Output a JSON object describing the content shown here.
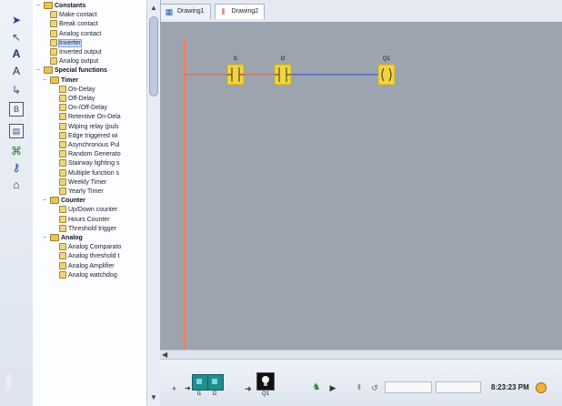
{
  "window": {
    "side_label": "Tools"
  },
  "toolbar_left": {
    "icons": [
      "arrow-icon",
      "select-icon",
      "letter-a-icon",
      "letter-a-arrow-icon",
      "connector-icon",
      "block-icon",
      "terminal-icon",
      "network-icon",
      "key-icon",
      "graph-icon"
    ]
  },
  "library": {
    "items": [
      {
        "label": "Constants",
        "kind": "folder",
        "level": 0,
        "toggle": "−"
      },
      {
        "label": "Make contact",
        "kind": "item",
        "level": 1,
        "toggle": ""
      },
      {
        "label": "Break contact",
        "kind": "item",
        "level": 1,
        "toggle": ""
      },
      {
        "label": "Analog contact",
        "kind": "item",
        "level": 1,
        "toggle": ""
      },
      {
        "label": "Inverter",
        "kind": "item",
        "level": 1,
        "toggle": "",
        "selected": true
      },
      {
        "label": "Inverted output",
        "kind": "item",
        "level": 1,
        "toggle": ""
      },
      {
        "label": "Analog output",
        "kind": "item",
        "level": 1,
        "toggle": ""
      },
      {
        "label": "Special functions",
        "kind": "folder",
        "level": 0,
        "toggle": "−"
      },
      {
        "label": "Timer",
        "kind": "folder",
        "level": 1,
        "toggle": "−"
      },
      {
        "label": "On-Delay",
        "kind": "item",
        "level": 2,
        "toggle": ""
      },
      {
        "label": "Off-Delay",
        "kind": "item",
        "level": 2,
        "toggle": ""
      },
      {
        "label": "On-/Off-Delay",
        "kind": "item",
        "level": 2,
        "toggle": ""
      },
      {
        "label": "Retentive On-Dela",
        "kind": "item",
        "level": 2,
        "toggle": ""
      },
      {
        "label": "Wiping relay (puls",
        "kind": "item",
        "level": 2,
        "toggle": ""
      },
      {
        "label": "Edge triggered wi",
        "kind": "item",
        "level": 2,
        "toggle": ""
      },
      {
        "label": "Asynchronous Pul",
        "kind": "item",
        "level": 2,
        "toggle": ""
      },
      {
        "label": "Random Generato",
        "kind": "item",
        "level": 2,
        "toggle": ""
      },
      {
        "label": "Stairway lighting s",
        "kind": "item",
        "level": 2,
        "toggle": ""
      },
      {
        "label": "Multiple function s",
        "kind": "item",
        "level": 2,
        "toggle": ""
      },
      {
        "label": "Weekly Timer",
        "kind": "item",
        "level": 2,
        "toggle": ""
      },
      {
        "label": "Yearly Timer",
        "kind": "item",
        "level": 2,
        "toggle": ""
      },
      {
        "label": "Counter",
        "kind": "folder",
        "level": 1,
        "toggle": "−"
      },
      {
        "label": "Up/Down counter",
        "kind": "item",
        "level": 2,
        "toggle": ""
      },
      {
        "label": "Hours Counter",
        "kind": "item",
        "level": 2,
        "toggle": ""
      },
      {
        "label": "Threshold trigger",
        "kind": "item",
        "level": 2,
        "toggle": ""
      },
      {
        "label": "Analog",
        "kind": "folder",
        "level": 1,
        "toggle": "−"
      },
      {
        "label": "Analog Comparato",
        "kind": "item",
        "level": 2,
        "toggle": ""
      },
      {
        "label": "Analog threshold t",
        "kind": "item",
        "level": 2,
        "toggle": ""
      },
      {
        "label": "Analog Amplifier",
        "kind": "item",
        "level": 2,
        "toggle": ""
      },
      {
        "label": "Analog watchdog",
        "kind": "item",
        "level": 2,
        "toggle": ""
      }
    ]
  },
  "tabs": [
    {
      "label": "Drawing1",
      "icon": "drawing-icon"
    },
    {
      "label": "Drawing2",
      "icon": "ladder-icon"
    }
  ],
  "ladder": {
    "rung_labels": [
      "I1",
      "I2",
      "Q1"
    ]
  },
  "status": {
    "inputs": [
      "I1",
      "I2"
    ],
    "output": "Q1",
    "time": "8:23:23 PM",
    "field1": "",
    "field2": ""
  }
}
